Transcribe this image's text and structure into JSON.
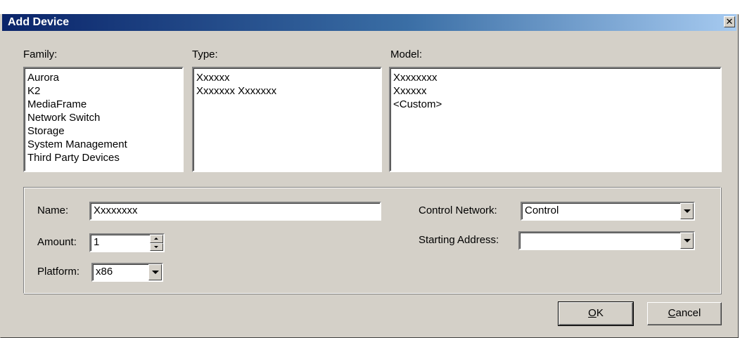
{
  "window": {
    "title": "Add Device",
    "close_glyph": "✕"
  },
  "family": {
    "label": "Family:",
    "items": [
      "Aurora",
      "K2",
      "MediaFrame",
      "Network Switch",
      "Storage",
      "System Management",
      "Third Party Devices"
    ]
  },
  "type": {
    "label": "Type:",
    "items": [
      "Xxxxxx",
      "Xxxxxxx Xxxxxxx"
    ]
  },
  "model": {
    "label": "Model:",
    "items": [
      "Xxxxxxxx",
      "Xxxxxx",
      "<Custom>"
    ]
  },
  "form": {
    "name_label": "Name:",
    "name_value": "Xxxxxxxx",
    "amount_label": "Amount:",
    "amount_value": "1",
    "platform_label": "Platform:",
    "platform_value": "x86",
    "control_network_label": "Control Network:",
    "control_network_value": "Control",
    "starting_address_label": "Starting Address:",
    "starting_address_value": ""
  },
  "buttons": {
    "ok_mnemonic": "O",
    "ok_rest": "K",
    "cancel_mnemonic": "C",
    "cancel_rest": "ancel"
  }
}
